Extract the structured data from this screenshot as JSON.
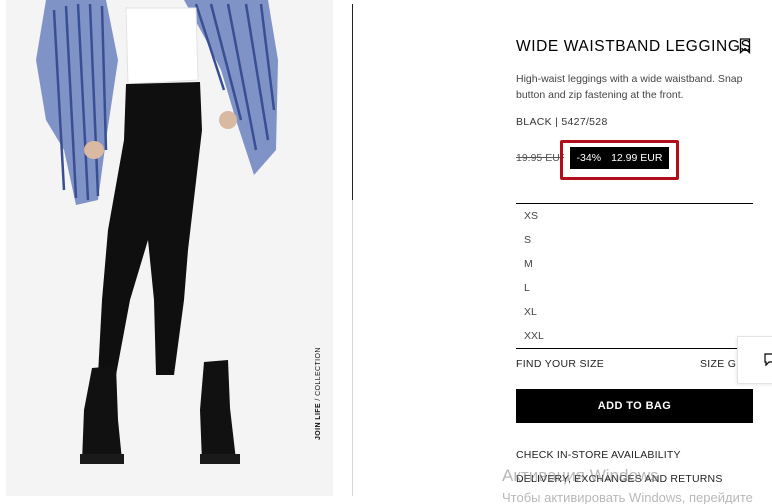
{
  "product": {
    "title": "WIDE WAISTBAND LEGGINGS",
    "description": "High-waist leggings with a wide waistband. Snap button and zip fastening at the front.",
    "reference": "BLACK | 5427/528",
    "old_price": "19.95 EUR",
    "discount": "-34%",
    "price": "12.99 EUR",
    "collection_bold": "JOIN LIFE",
    "collection_rest": " / COLLECTION"
  },
  "sizes": [
    "XS",
    "S",
    "M",
    "L",
    "XL",
    "XXL"
  ],
  "actions": {
    "find_size": "FIND YOUR SIZE",
    "size_guide": "SIZE GUIDE",
    "add_to_bag": "ADD TO BAG",
    "check_store": "CHECK IN-STORE AVAILABILITY",
    "delivery": "DELIVERY, EXCHANGES AND RETURNS"
  },
  "watermark": {
    "line1": "Активация Windows",
    "line2": "Чтобы активировать Windows, перейдите"
  },
  "colors": {
    "highlight": "#b00e1a",
    "badge_bg": "#000000",
    "button_bg": "#000000"
  },
  "icons": [
    "bookmark-icon",
    "chat-icon"
  ]
}
